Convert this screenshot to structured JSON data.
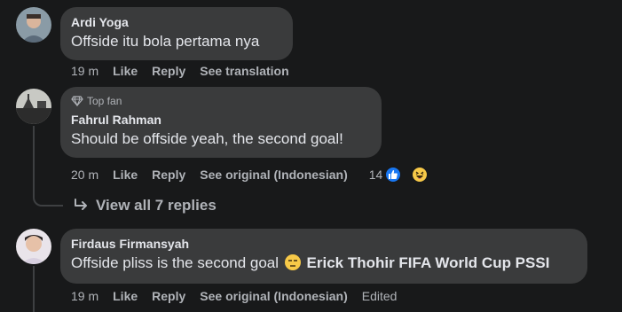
{
  "comments": [
    {
      "author": "Ardi Yoga",
      "text": "Offside itu bola pertama nya",
      "time": "19 m",
      "like": "Like",
      "reply": "Reply",
      "extra": "See translation"
    },
    {
      "badge": "Top fan",
      "author": "Fahrul Rahman",
      "text": "Should be offside yeah, the second goal!",
      "time": "20 m",
      "like": "Like",
      "reply": "Reply",
      "extra": "See original (Indonesian)",
      "reaction_count": "14",
      "view_replies": "View all 7 replies"
    },
    {
      "author": "Firdaus Firmansyah",
      "text_before": "Offside pliss is the second goal",
      "mention": "Erick Thohir FIFA World Cup PSSI",
      "time": "19 m",
      "like": "Like",
      "reply": "Reply",
      "extra": "See original (Indonesian)",
      "edited": "Edited"
    }
  ],
  "colors": {
    "background": "#18191a",
    "bubble": "#3a3b3c",
    "text": "#e4e6eb",
    "muted": "#b0b3b8",
    "like_blue": "#1877f2"
  },
  "icons": [
    "diamond-icon",
    "reply-arrow-icon",
    "like-reaction-icon",
    "haha-reaction-icon",
    "unamused-emoji-icon"
  ]
}
